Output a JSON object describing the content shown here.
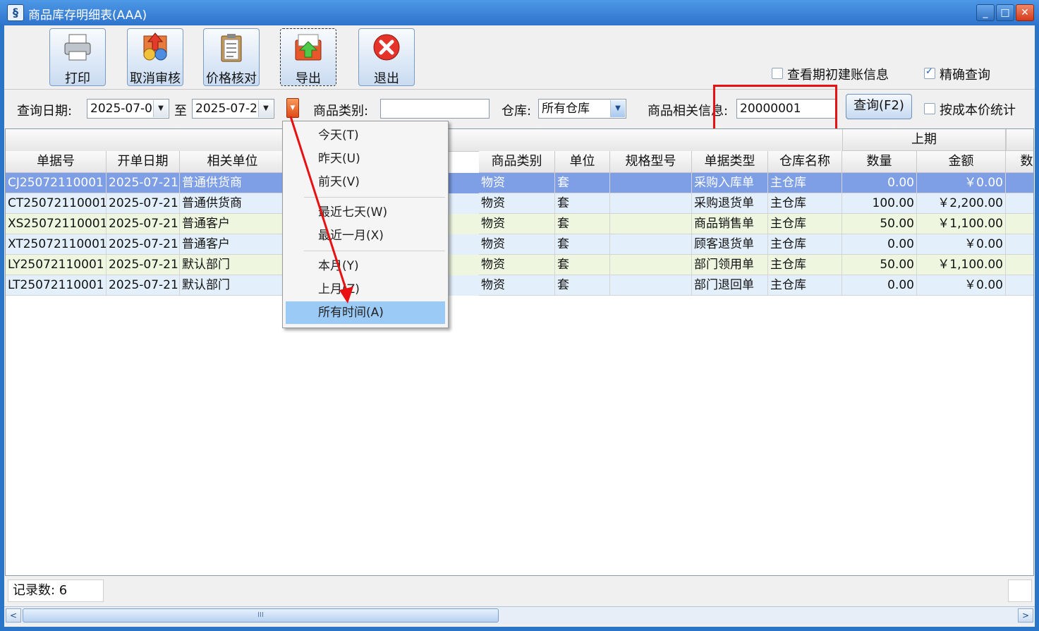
{
  "window": {
    "title": "商品库存明细表(AAA)",
    "icon": "app-icon",
    "min_label": "_",
    "max_label": "□",
    "close_label": "✕"
  },
  "toolbar": {
    "buttons": [
      {
        "label": "打印",
        "icon": "printer-icon"
      },
      {
        "label": "取消审核",
        "icon": "cancel-review-icon"
      },
      {
        "label": "价格核对",
        "icon": "clipboard-icon"
      },
      {
        "label": "导出",
        "icon": "export-icon"
      },
      {
        "label": "退出",
        "icon": "exit-icon"
      }
    ],
    "opening_info_label": "查看期初建账信息",
    "opening_info_checked": false,
    "exact_query_label": "精确查询",
    "exact_query_checked": true
  },
  "filters": {
    "date_label": "查询日期:",
    "date_from": "2025-07-0",
    "to_label": "至",
    "date_to": "2025-07-2",
    "category_label": "商品类别:",
    "category_value": "",
    "warehouse_label": "仓库:",
    "warehouse_value": "所有仓库",
    "product_info_label": "商品相关信息:",
    "product_info_value": "20000001",
    "query_button": "查询(F2)",
    "cost_stat_label": "按成本价统计",
    "cost_stat_checked": false
  },
  "date_menu": {
    "groups": [
      [
        "今天(T)",
        "昨天(U)",
        "前天(V)"
      ],
      [
        "最近七天(W)",
        "最近一月(X)"
      ],
      [
        "本月(Y)",
        "上月(Z)",
        "所有时间(A)"
      ]
    ],
    "selected": "所有时间(A)"
  },
  "table": {
    "group_header": "上期",
    "columns": [
      "单据号",
      "开单日期",
      "相关单位",
      "商品类别",
      "单位",
      "规格型号",
      "单据类型",
      "仓库名称",
      "数量",
      "金额",
      "数"
    ],
    "rows": [
      [
        "CJ25072110001",
        "2025-07-21",
        "普通供货商",
        "物资",
        "套",
        "",
        "采购入库单",
        "主仓库",
        "0.00",
        "￥0.00"
      ],
      [
        "CT25072110001",
        "2025-07-21",
        "普通供货商",
        "物资",
        "套",
        "",
        "采购退货单",
        "主仓库",
        "100.00",
        "￥2,200.00"
      ],
      [
        "XS25072110001",
        "2025-07-21",
        "普通客户",
        "物资",
        "套",
        "",
        "商品销售单",
        "主仓库",
        "50.00",
        "￥1,100.00"
      ],
      [
        "XT25072110001",
        "2025-07-21",
        "普通客户",
        "物资",
        "套",
        "",
        "顾客退货单",
        "主仓库",
        "0.00",
        "￥0.00"
      ],
      [
        "LY25072110001",
        "2025-07-21",
        "默认部门",
        "物资",
        "套",
        "",
        "部门领用单",
        "主仓库",
        "50.00",
        "￥1,100.00"
      ],
      [
        "LT25072110001",
        "2025-07-21",
        "默认部门",
        "物资",
        "套",
        "",
        "部门退回单",
        "主仓库",
        "0.00",
        "￥0.00"
      ]
    ],
    "selected_row": 0
  },
  "status": {
    "record_count_label": "记录数: 6"
  },
  "scrollbar": {
    "left_arrow": "<",
    "right_arrow": ">",
    "thumb_grip": "III"
  },
  "colors": {
    "title_bar": "#2f74cc",
    "selected_row": "#7e9ee6",
    "row_even": "#e3f0fb",
    "row_odd": "#eef6e0",
    "menu_highlight": "#9ccaf6",
    "annotation_red": "#e81010"
  }
}
